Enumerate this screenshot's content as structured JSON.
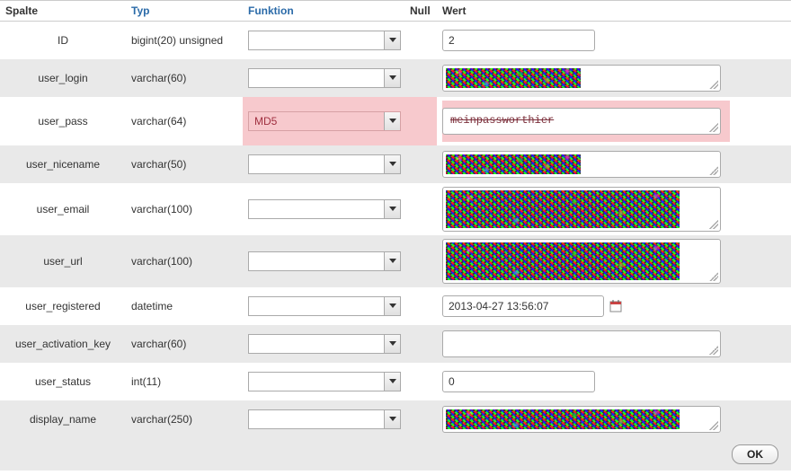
{
  "headers": {
    "spalte": "Spalte",
    "typ": "Typ",
    "funktion": "Funktion",
    "null": "Null",
    "wert": "Wert"
  },
  "rows": [
    {
      "col": "ID",
      "type": "bigint(20) unsigned",
      "func": "",
      "value": "2",
      "input": "text",
      "censor": false,
      "highlight": false
    },
    {
      "col": "user_login",
      "type": "varchar(60)",
      "func": "",
      "value": "",
      "input": "textarea",
      "censor": "narrow",
      "highlight": false
    },
    {
      "col": "user_pass",
      "type": "varchar(64)",
      "func": "MD5",
      "value": "meinpassworthier",
      "input": "passbox",
      "censor": false,
      "highlight": true
    },
    {
      "col": "user_nicename",
      "type": "varchar(50)",
      "func": "",
      "value": "",
      "input": "textarea",
      "censor": "narrow",
      "highlight": false
    },
    {
      "col": "user_email",
      "type": "varchar(100)",
      "func": "",
      "value": "",
      "input": "textarea-tall",
      "censor": "wide",
      "highlight": false
    },
    {
      "col": "user_url",
      "type": "varchar(100)",
      "func": "",
      "value": "",
      "input": "textarea-tall",
      "censor": "wide",
      "highlight": false
    },
    {
      "col": "user_registered",
      "type": "datetime",
      "func": "",
      "value": "2013-04-27 13:56:07",
      "input": "datetime",
      "censor": false,
      "highlight": false
    },
    {
      "col": "user_activation_key",
      "type": "varchar(60)",
      "func": "",
      "value": "",
      "input": "textarea",
      "censor": false,
      "highlight": false
    },
    {
      "col": "user_status",
      "type": "int(11)",
      "func": "",
      "value": "0",
      "input": "text",
      "censor": false,
      "highlight": false
    },
    {
      "col": "display_name",
      "type": "varchar(250)",
      "func": "",
      "value": "",
      "input": "textarea",
      "censor": "wide",
      "highlight": false
    }
  ],
  "buttons": {
    "ok": "OK"
  }
}
